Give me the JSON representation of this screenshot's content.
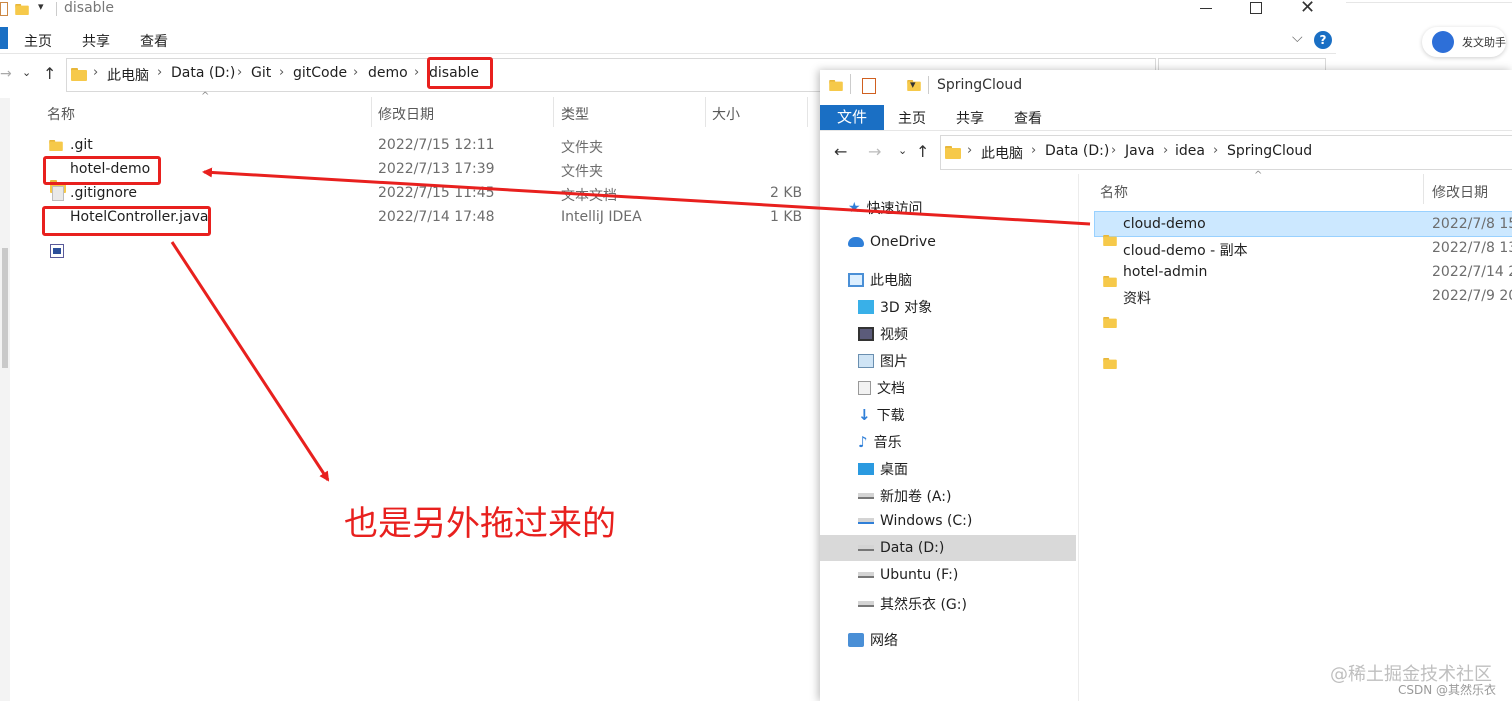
{
  "win1": {
    "title": "disable",
    "menu": [
      "主页",
      "共享",
      "查看"
    ],
    "breadcrumb": [
      "此电脑",
      "Data (D:)",
      "Git",
      "gitCode",
      "demo",
      "disable"
    ],
    "columns": {
      "name": "名称",
      "date": "修改日期",
      "type": "类型",
      "size": "大小"
    },
    "rows": [
      {
        "name": ".git",
        "date": "2022/7/15 12:11",
        "type": "文件夹",
        "size": ""
      },
      {
        "name": "hotel-demo",
        "date": "2022/7/13 17:39",
        "type": "文件夹",
        "size": ""
      },
      {
        "name": ".gitignore",
        "date": "2022/7/15 11:45",
        "type": "文本文档",
        "size": "2 KB"
      },
      {
        "name": "HotelController.java",
        "date": "2022/7/14 17:48",
        "type": "IntelliJ IDEA",
        "size": "1 KB"
      }
    ]
  },
  "annotation": {
    "text": "也是另外拖过来的",
    "color": "#e8201e"
  },
  "assistant_badge": {
    "label": "发文助手"
  },
  "win2": {
    "title": "SpringCloud",
    "tabs": {
      "file": "文件",
      "home": "主页",
      "share": "共享",
      "view": "查看"
    },
    "breadcrumb": [
      "此电脑",
      "Data (D:)",
      "Java",
      "idea",
      "SpringCloud"
    ],
    "columns": {
      "name": "名称",
      "date": "修改日期"
    },
    "nav": [
      {
        "label": "快速访问",
        "icon": "star-icon"
      },
      {
        "label": "OneDrive",
        "icon": "cloud-icon"
      },
      {
        "label": "此电脑",
        "icon": "computer-icon"
      },
      {
        "label": "3D 对象",
        "icon": "cube-icon"
      },
      {
        "label": "视频",
        "icon": "video-icon"
      },
      {
        "label": "图片",
        "icon": "picture-icon"
      },
      {
        "label": "文档",
        "icon": "document-icon"
      },
      {
        "label": "下载",
        "icon": "download-icon"
      },
      {
        "label": "音乐",
        "icon": "music-icon"
      },
      {
        "label": "桌面",
        "icon": "desktop-icon"
      },
      {
        "label": "新加卷 (A:)",
        "icon": "drive-icon"
      },
      {
        "label": "Windows (C:)",
        "icon": "windows-drive-icon"
      },
      {
        "label": "Data (D:)",
        "icon": "drive-icon"
      },
      {
        "label": "Ubuntu (F:)",
        "icon": "drive-icon"
      },
      {
        "label": "其然乐衣 (G:)",
        "icon": "drive-icon"
      },
      {
        "label": "网络",
        "icon": "network-icon"
      }
    ],
    "rows": [
      {
        "name": "cloud-demo",
        "date": "2022/7/8 15"
      },
      {
        "name": "cloud-demo - 副本",
        "date": "2022/7/8 13"
      },
      {
        "name": "hotel-admin",
        "date": "2022/7/14 2"
      },
      {
        "name": "资料",
        "date": "2022/7/9 20"
      }
    ]
  },
  "watermark": {
    "main": "@稀土掘金技术社区",
    "sub": "CSDN @其然乐衣"
  }
}
